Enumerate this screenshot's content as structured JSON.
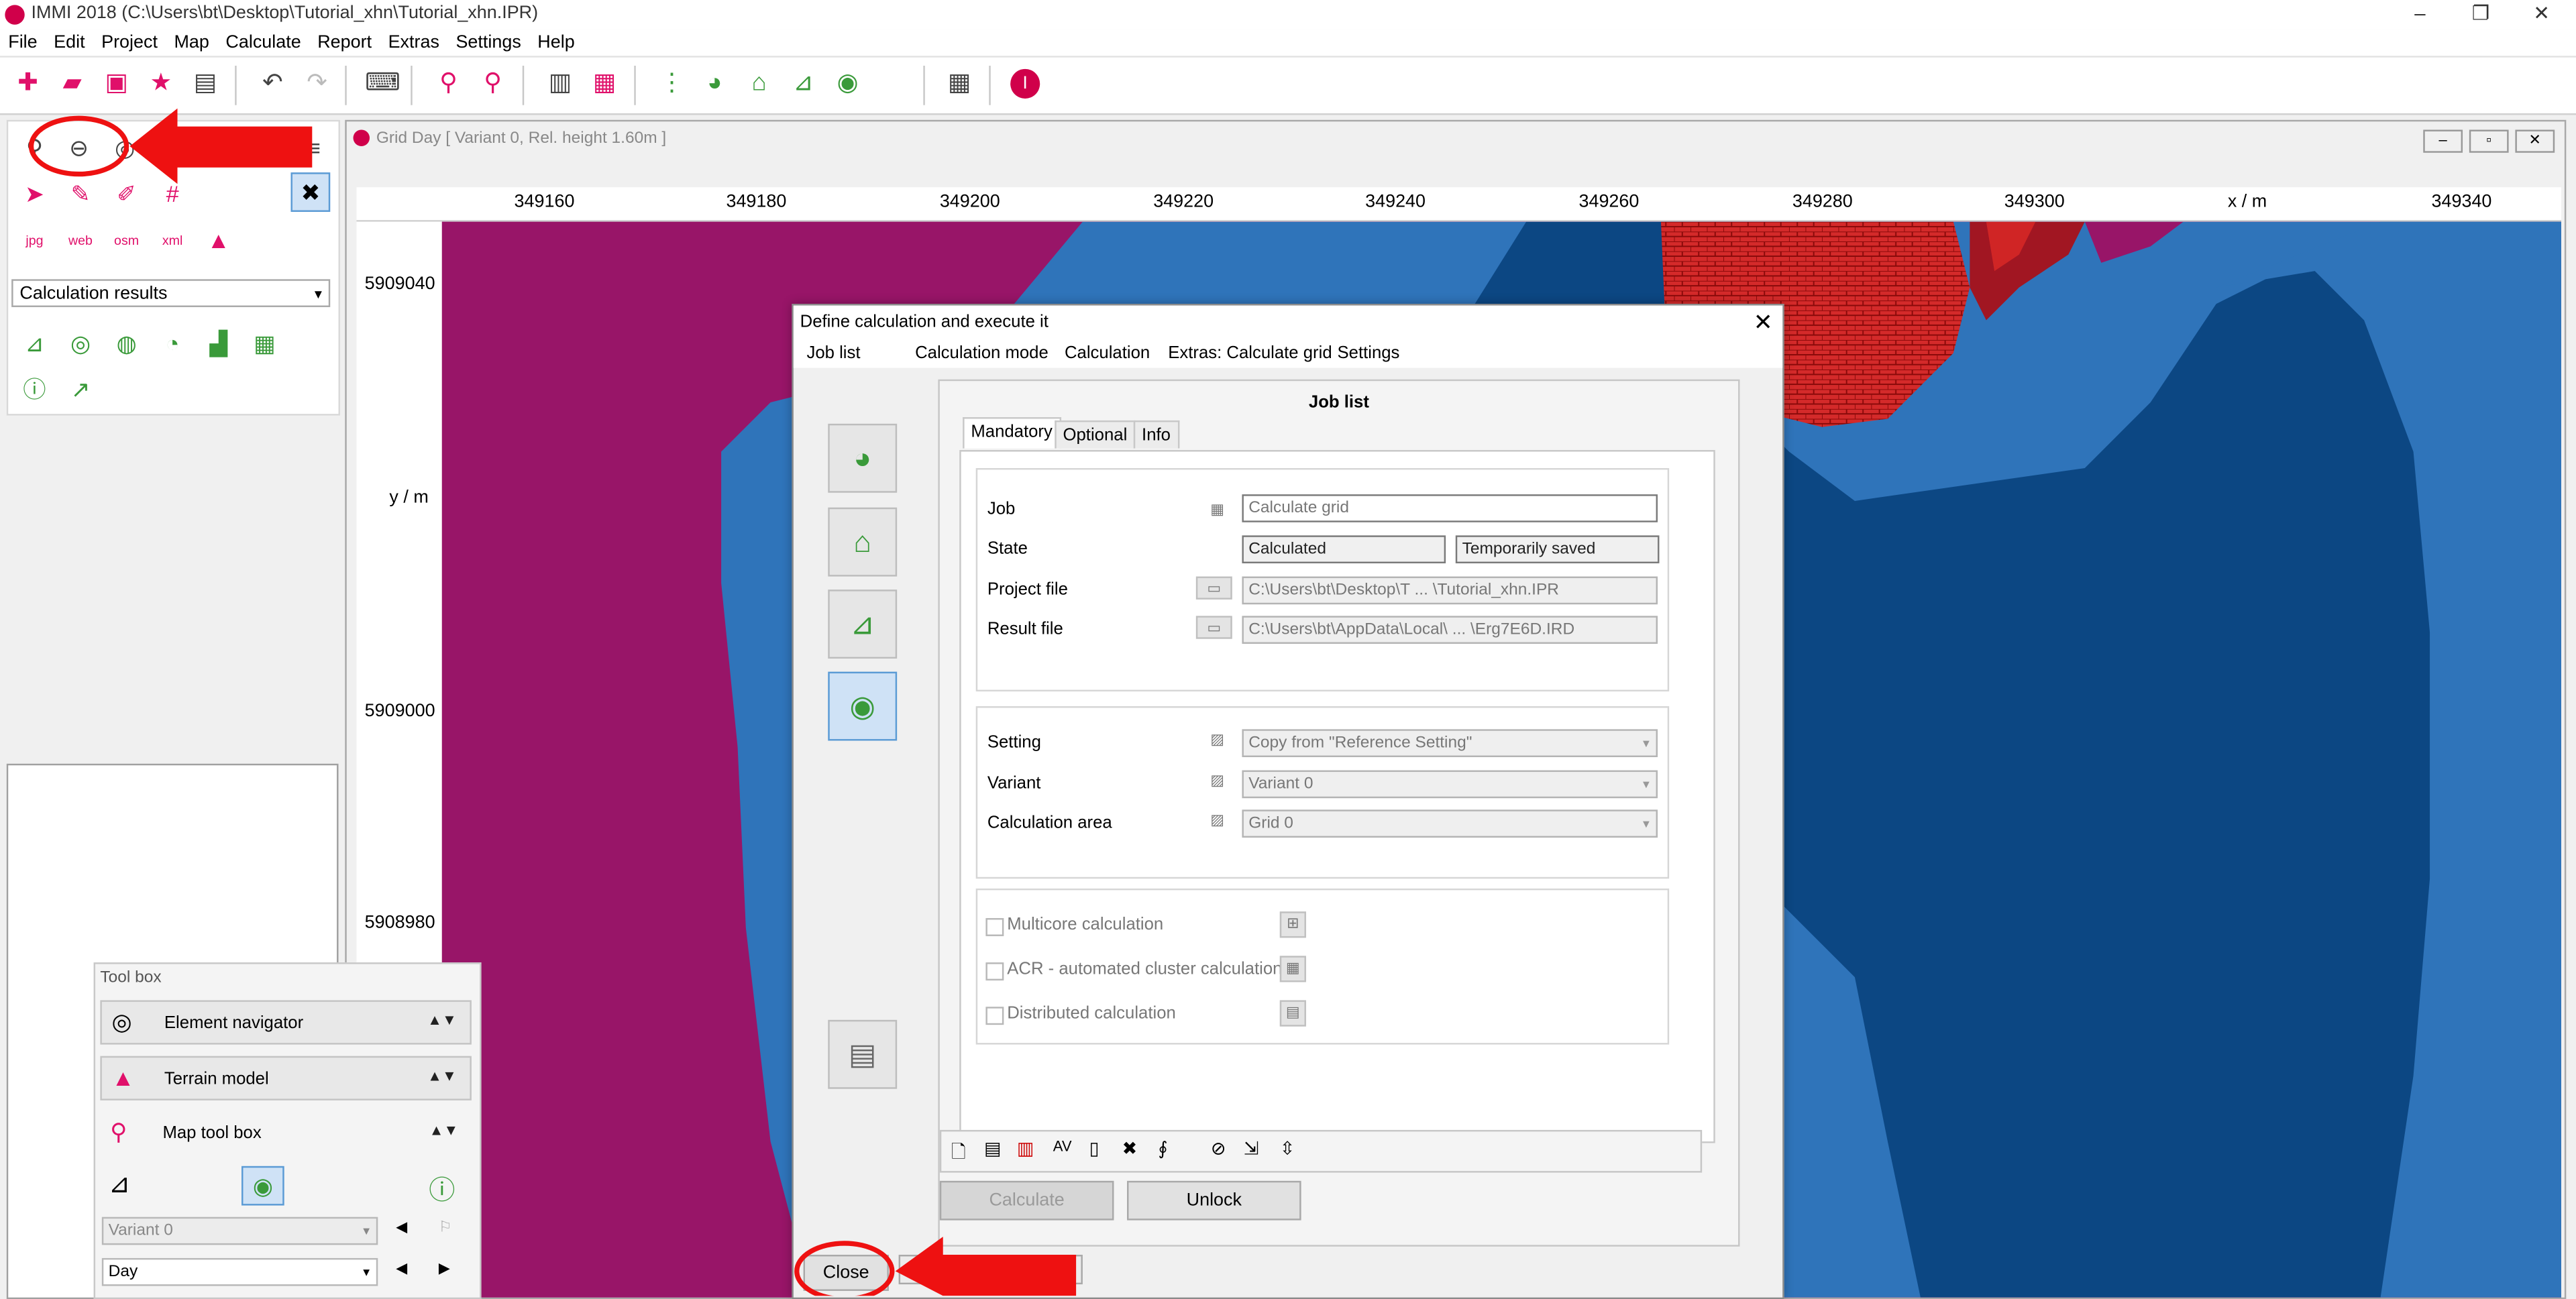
{
  "app": {
    "title": "IMMI 2018 (C:\\Users\\bt\\Desktop\\Tutorial_xhn\\Tutorial_xhn.IPR)",
    "window_controls": [
      "–",
      "❐",
      "✕"
    ]
  },
  "menu": [
    "File",
    "Edit",
    "Project",
    "Map",
    "Calculate",
    "Report",
    "Extras",
    "Settings",
    "Help"
  ],
  "left_panel": {
    "dropdown_value": "Calculation results",
    "map_labels": [
      "jpg",
      "web",
      "osm",
      "xml"
    ]
  },
  "toolbox": {
    "title": "Tool box",
    "items": [
      "Element navigator",
      "Terrain model",
      "Map tool box"
    ],
    "variant_value": "Variant 0",
    "period_value": "Day"
  },
  "map_window": {
    "title": "Grid Day  [ Variant 0, Rel. height  1.60m ]",
    "x_ticks": [
      "349160",
      "349180",
      "349200",
      "349220",
      "349240",
      "349260",
      "349280",
      "349300",
      "x / m",
      "349340"
    ],
    "y_axis_label": "y / m",
    "y_ticks": [
      "5909040",
      "5909000",
      "5908980"
    ]
  },
  "dialog": {
    "title": "Define calculation and execute it",
    "menu": [
      "Job list",
      "Calculation mode",
      "Calculation",
      "Extras: Calculate grid",
      "Settings"
    ],
    "heading": "Job list",
    "tabs": [
      "Mandatory",
      "Optional",
      "Info"
    ],
    "fields": {
      "job_label": "Job",
      "job_placeholder": "Calculate grid",
      "state_label": "State",
      "state_value": "Calculated",
      "state_value2": "Temporarily saved",
      "project_file_label": "Project file",
      "project_file_value": "C:\\Users\\bt\\Desktop\\T ... \\Tutorial_xhn.IPR",
      "result_file_label": "Result file",
      "result_file_value": "C:\\Users\\bt\\AppData\\Local\\ ... \\Erg7E6D.IRD",
      "setting_label": "Setting",
      "setting_value": "Copy from \"Reference Setting\"",
      "variant_label": "Variant",
      "variant_value": "Variant 0",
      "calc_area_label": "Calculation area",
      "calc_area_value": "Grid 0"
    },
    "options": [
      "Multicore calculation",
      "ACR - automated cluster calculation",
      "Distributed calculation"
    ],
    "buttons": {
      "calculate": "Calculate",
      "unlock": "Unlock",
      "close": "Close"
    }
  },
  "colors": {
    "map_magenta": "#981568",
    "map_light_blue": "#2f74ba",
    "map_dark_blue": "#0c4783",
    "map_red": "#c81e1e",
    "annotation_red": "#ee1111",
    "brand_pink": "#e0106a"
  }
}
